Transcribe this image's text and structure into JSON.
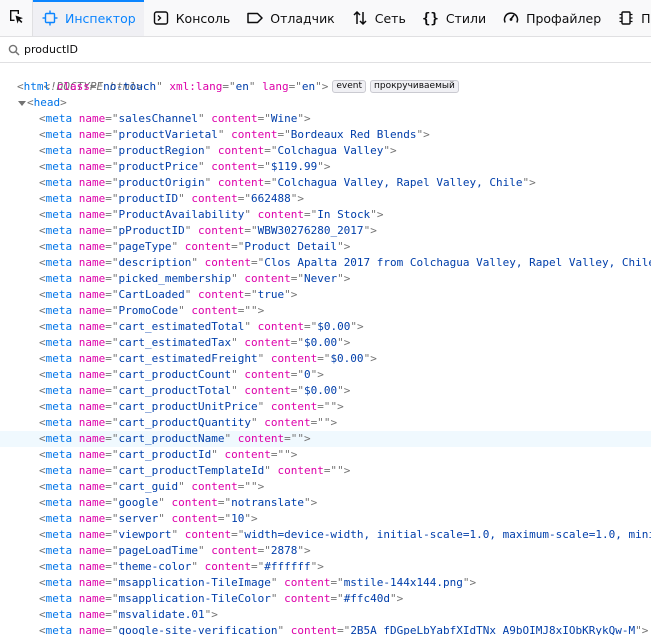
{
  "toolbar": {
    "tabs": [
      {
        "label": "Инспектор",
        "icon": "inspector-icon",
        "selected": true
      },
      {
        "label": "Консоль",
        "icon": "console-icon",
        "selected": false
      },
      {
        "label": "Отладчик",
        "icon": "debugger-icon",
        "selected": false
      },
      {
        "label": "Сеть",
        "icon": "network-icon",
        "selected": false
      },
      {
        "label": "Стили",
        "icon": "style-editor-icon",
        "selected": false
      },
      {
        "label": "Профайлер",
        "icon": "profiler-icon",
        "selected": false
      },
      {
        "label": "Память",
        "icon": "memory-icon",
        "selected": false
      }
    ],
    "accent_color": "#0a84ff"
  },
  "search": {
    "value": "productID",
    "icon": "search-icon"
  },
  "markup": {
    "doctype": "<!DOCTYPE html>",
    "html": {
      "tag": "html",
      "attrs": [
        {
          "name": "class",
          "value": "no-touch"
        },
        {
          "name": "xml:lang",
          "value": "en"
        },
        {
          "name": "lang",
          "value": "en"
        }
      ],
      "badges": [
        "event",
        "прокручиваемый"
      ]
    },
    "head": {
      "tag": "head"
    },
    "meta_tags": [
      {
        "name": "salesChannel",
        "content": "Wine"
      },
      {
        "name": "productVarietal",
        "content": "Bordeaux Red Blends"
      },
      {
        "name": "productRegion",
        "content": "Colchagua Valley"
      },
      {
        "name": "productPrice",
        "content": "$119.99"
      },
      {
        "name": "productOrigin",
        "content": "Colchagua Valley, Rapel Valley, Chile"
      },
      {
        "name": "productID",
        "content": "662488"
      },
      {
        "name": "ProductAvailability",
        "content": "In Stock"
      },
      {
        "name": "pProductID",
        "content": "WBW30276280_2017"
      },
      {
        "name": "pageType",
        "content": "Product Detail"
      },
      {
        "name": "description",
        "content": "Clos Apalta 2017 from Colchagua Valley, Rapel Valley, Chile"
      },
      {
        "name": "picked_membership",
        "content": "Never"
      },
      {
        "name": "CartLoaded",
        "content": "true"
      },
      {
        "name": "PromoCode",
        "content": ""
      },
      {
        "name": "cart_estimatedTotal",
        "content": "$0.00"
      },
      {
        "name": "cart_estimatedTax",
        "content": "$0.00"
      },
      {
        "name": "cart_estimatedFreight",
        "content": "$0.00"
      },
      {
        "name": "cart_productCount",
        "content": "0"
      },
      {
        "name": "cart_productTotal",
        "content": "$0.00"
      },
      {
        "name": "cart_productUnitPrice",
        "content": ""
      },
      {
        "name": "cart_productQuantity",
        "content": ""
      },
      {
        "name": "cart_productName",
        "content": "",
        "highlighted": true
      },
      {
        "name": "cart_productId",
        "content": ""
      },
      {
        "name": "cart_productTemplateId",
        "content": ""
      },
      {
        "name": "cart_guid",
        "content": ""
      },
      {
        "name": "google",
        "content": "notranslate"
      },
      {
        "name": "server",
        "content": "10"
      },
      {
        "name": "viewport",
        "content": "width=device-width, initial-scale=1.0, maximum-scale=1.0, mini"
      },
      {
        "name": "pageLoadTime",
        "content": "2878"
      },
      {
        "name": "theme-color",
        "content": "#ffffff"
      },
      {
        "name": "msapplication-TileImage",
        "content": "mstile-144x144.png"
      },
      {
        "name": "msapplication-TileColor",
        "content": "#ffc40d"
      },
      {
        "name": "msvalidate.01",
        "content": null
      },
      {
        "name": "google-site-verification",
        "content": "2B5A_fDGpeLbYabfXIdTNx_A9bOIMJ8xIObKRykQw-M"
      }
    ]
  },
  "colors": {
    "tag": "#0074e8",
    "attr_name": "#dd00a9",
    "attr_value": "#003eaa",
    "punct": "#737373",
    "highlight_row": "#f0f9fe"
  }
}
